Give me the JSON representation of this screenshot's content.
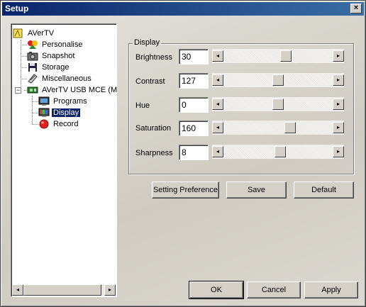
{
  "window": {
    "title": "Setup",
    "close_glyph": "×"
  },
  "tree": {
    "items": [
      {
        "label": "AVerTV",
        "icon": "avertv-icon"
      },
      {
        "label": "Personalise",
        "icon": "personalise-icon"
      },
      {
        "label": "Snapshot",
        "icon": "camera-icon"
      },
      {
        "label": "Storage",
        "icon": "floppy-disk-icon"
      },
      {
        "label": "Miscellaneous",
        "icon": "miscellaneous-icon"
      },
      {
        "label": "AVerTV USB MCE (M",
        "icon": "usb-device-icon"
      },
      {
        "label": "Programs",
        "icon": "programs-icon"
      },
      {
        "label": "Display",
        "icon": "display-icon",
        "selected": true
      },
      {
        "label": "Record",
        "icon": "record-icon"
      }
    ],
    "expander_glyph": "−"
  },
  "display_group": {
    "title": "Display",
    "settings": [
      {
        "label": "Brightness",
        "value": "30",
        "level": 0.58
      },
      {
        "label": "Contrast",
        "value": "127",
        "level": 0.5
      },
      {
        "label": "Hue",
        "value": "0",
        "level": 0.5
      },
      {
        "label": "Saturation",
        "value": "160",
        "level": 0.62
      },
      {
        "label": "Sharpness",
        "value": "8",
        "level": 0.52
      }
    ]
  },
  "actions": {
    "setting_preference": "Setting Preference",
    "save": "Save",
    "default": "Default"
  },
  "footer": {
    "ok": "OK",
    "cancel": "Cancel",
    "apply": "Apply"
  },
  "glyphs": {
    "left_arrow": "◂",
    "right_arrow": "▸"
  }
}
